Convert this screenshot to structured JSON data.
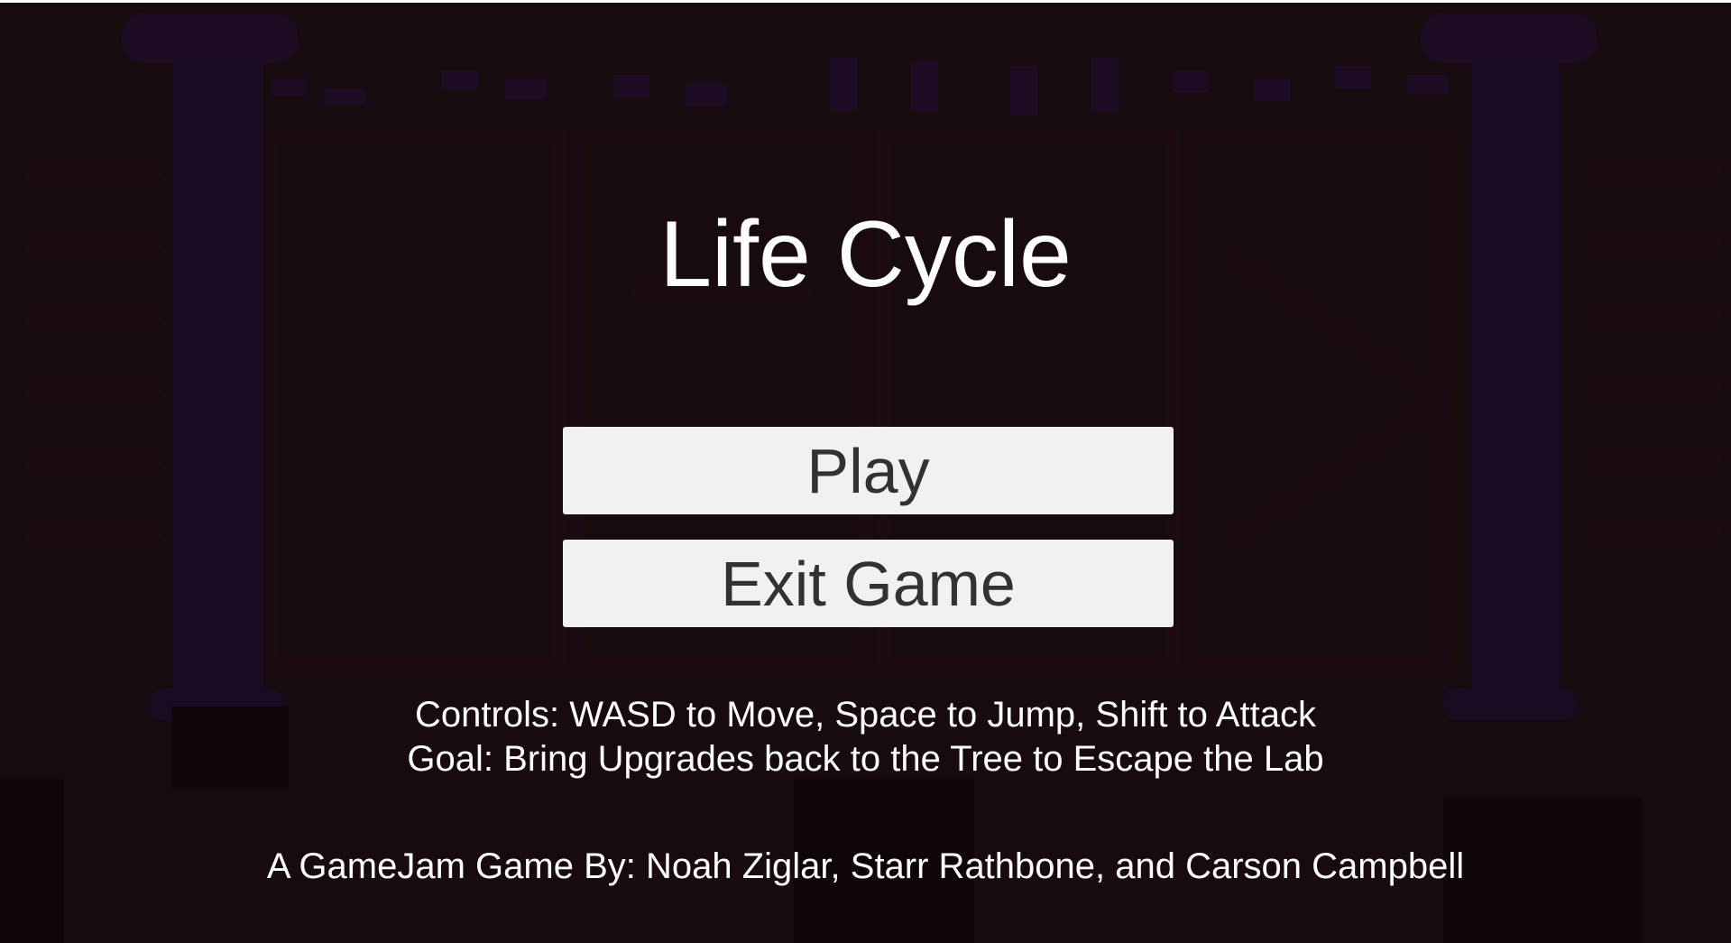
{
  "game": {
    "title": "Life Cycle"
  },
  "menu": {
    "play_label": "Play",
    "exit_label": "Exit Game"
  },
  "info": {
    "controls": "Controls: WASD to Move, Space to Jump, Shift to Attack",
    "goal": "Goal: Bring Upgrades back to the Tree to Escape the Lab"
  },
  "credits": {
    "text": "A GameJam Game By: Noah Ziglar, Starr Rathbone, and Carson Campbell"
  },
  "colors": {
    "background": "#170b10",
    "background_shapes": "#1a0c22",
    "button_fill": "#f1f1f1",
    "button_text": "#323232",
    "text": "#ffffff"
  }
}
